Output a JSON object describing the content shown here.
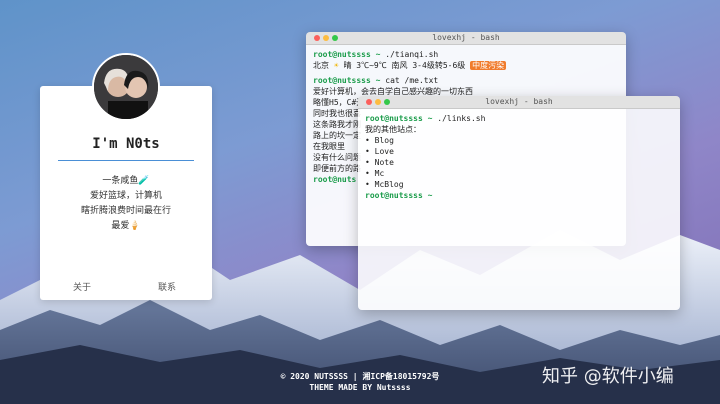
{
  "profile": {
    "name": "I'm N0ts",
    "bio": [
      "一条咸鱼🧪",
      "爱好篮球，计算机",
      "瞎折腾浪费时间最在行",
      "最爱🍦"
    ],
    "links": {
      "about": "关于",
      "contact": "联系"
    }
  },
  "terminal1": {
    "title": "lovexhj - bash",
    "lines": [
      {
        "prompt": "root@nutssss ~",
        "cmd": " ./tianqi.sh"
      },
      {
        "text_a": "北京 ",
        "text_b": "☀",
        "text_c": " 晴 3℃~9℃ 南风 3-4级转5-6级 ",
        "badge": "中度污染"
      },
      {
        "prompt": "root@nutssss ~",
        "cmd": " cat /me.txt"
      },
      {
        "text": "爱好计算机，会去自学自己感兴趣的一切东西"
      },
      {
        "text": "略懂H5，C#开"
      },
      {
        "text": "同时我也很喜"
      },
      {
        "text": "这条路我才刚"
      },
      {
        "text": "路上的坎一定"
      },
      {
        "text": "在我眼里"
      },
      {
        "text": "没有什么问题"
      },
      {
        "text": "即便前方的路"
      },
      {
        "prompt": "root@nuts",
        "cmd": ""
      }
    ]
  },
  "terminal2": {
    "title": "lovexhj - bash",
    "lines": [
      {
        "prompt": "root@nutssss ~",
        "cmd": " ./links.sh"
      },
      {
        "text": "我的其他站点："
      },
      {
        "text": "• Blog"
      },
      {
        "text": "• Love"
      },
      {
        "text": "• Note"
      },
      {
        "text": "• Mc"
      },
      {
        "text": "• McBlog"
      },
      {
        "prompt": "root@nutssss ~",
        "cmd": ""
      }
    ]
  },
  "footer": {
    "line1": "© 2020 NUTSSSS | 湘ICP备18015792号",
    "line2": "THEME MADE BY Nutssss"
  },
  "watermark": "知乎 @软件小编"
}
